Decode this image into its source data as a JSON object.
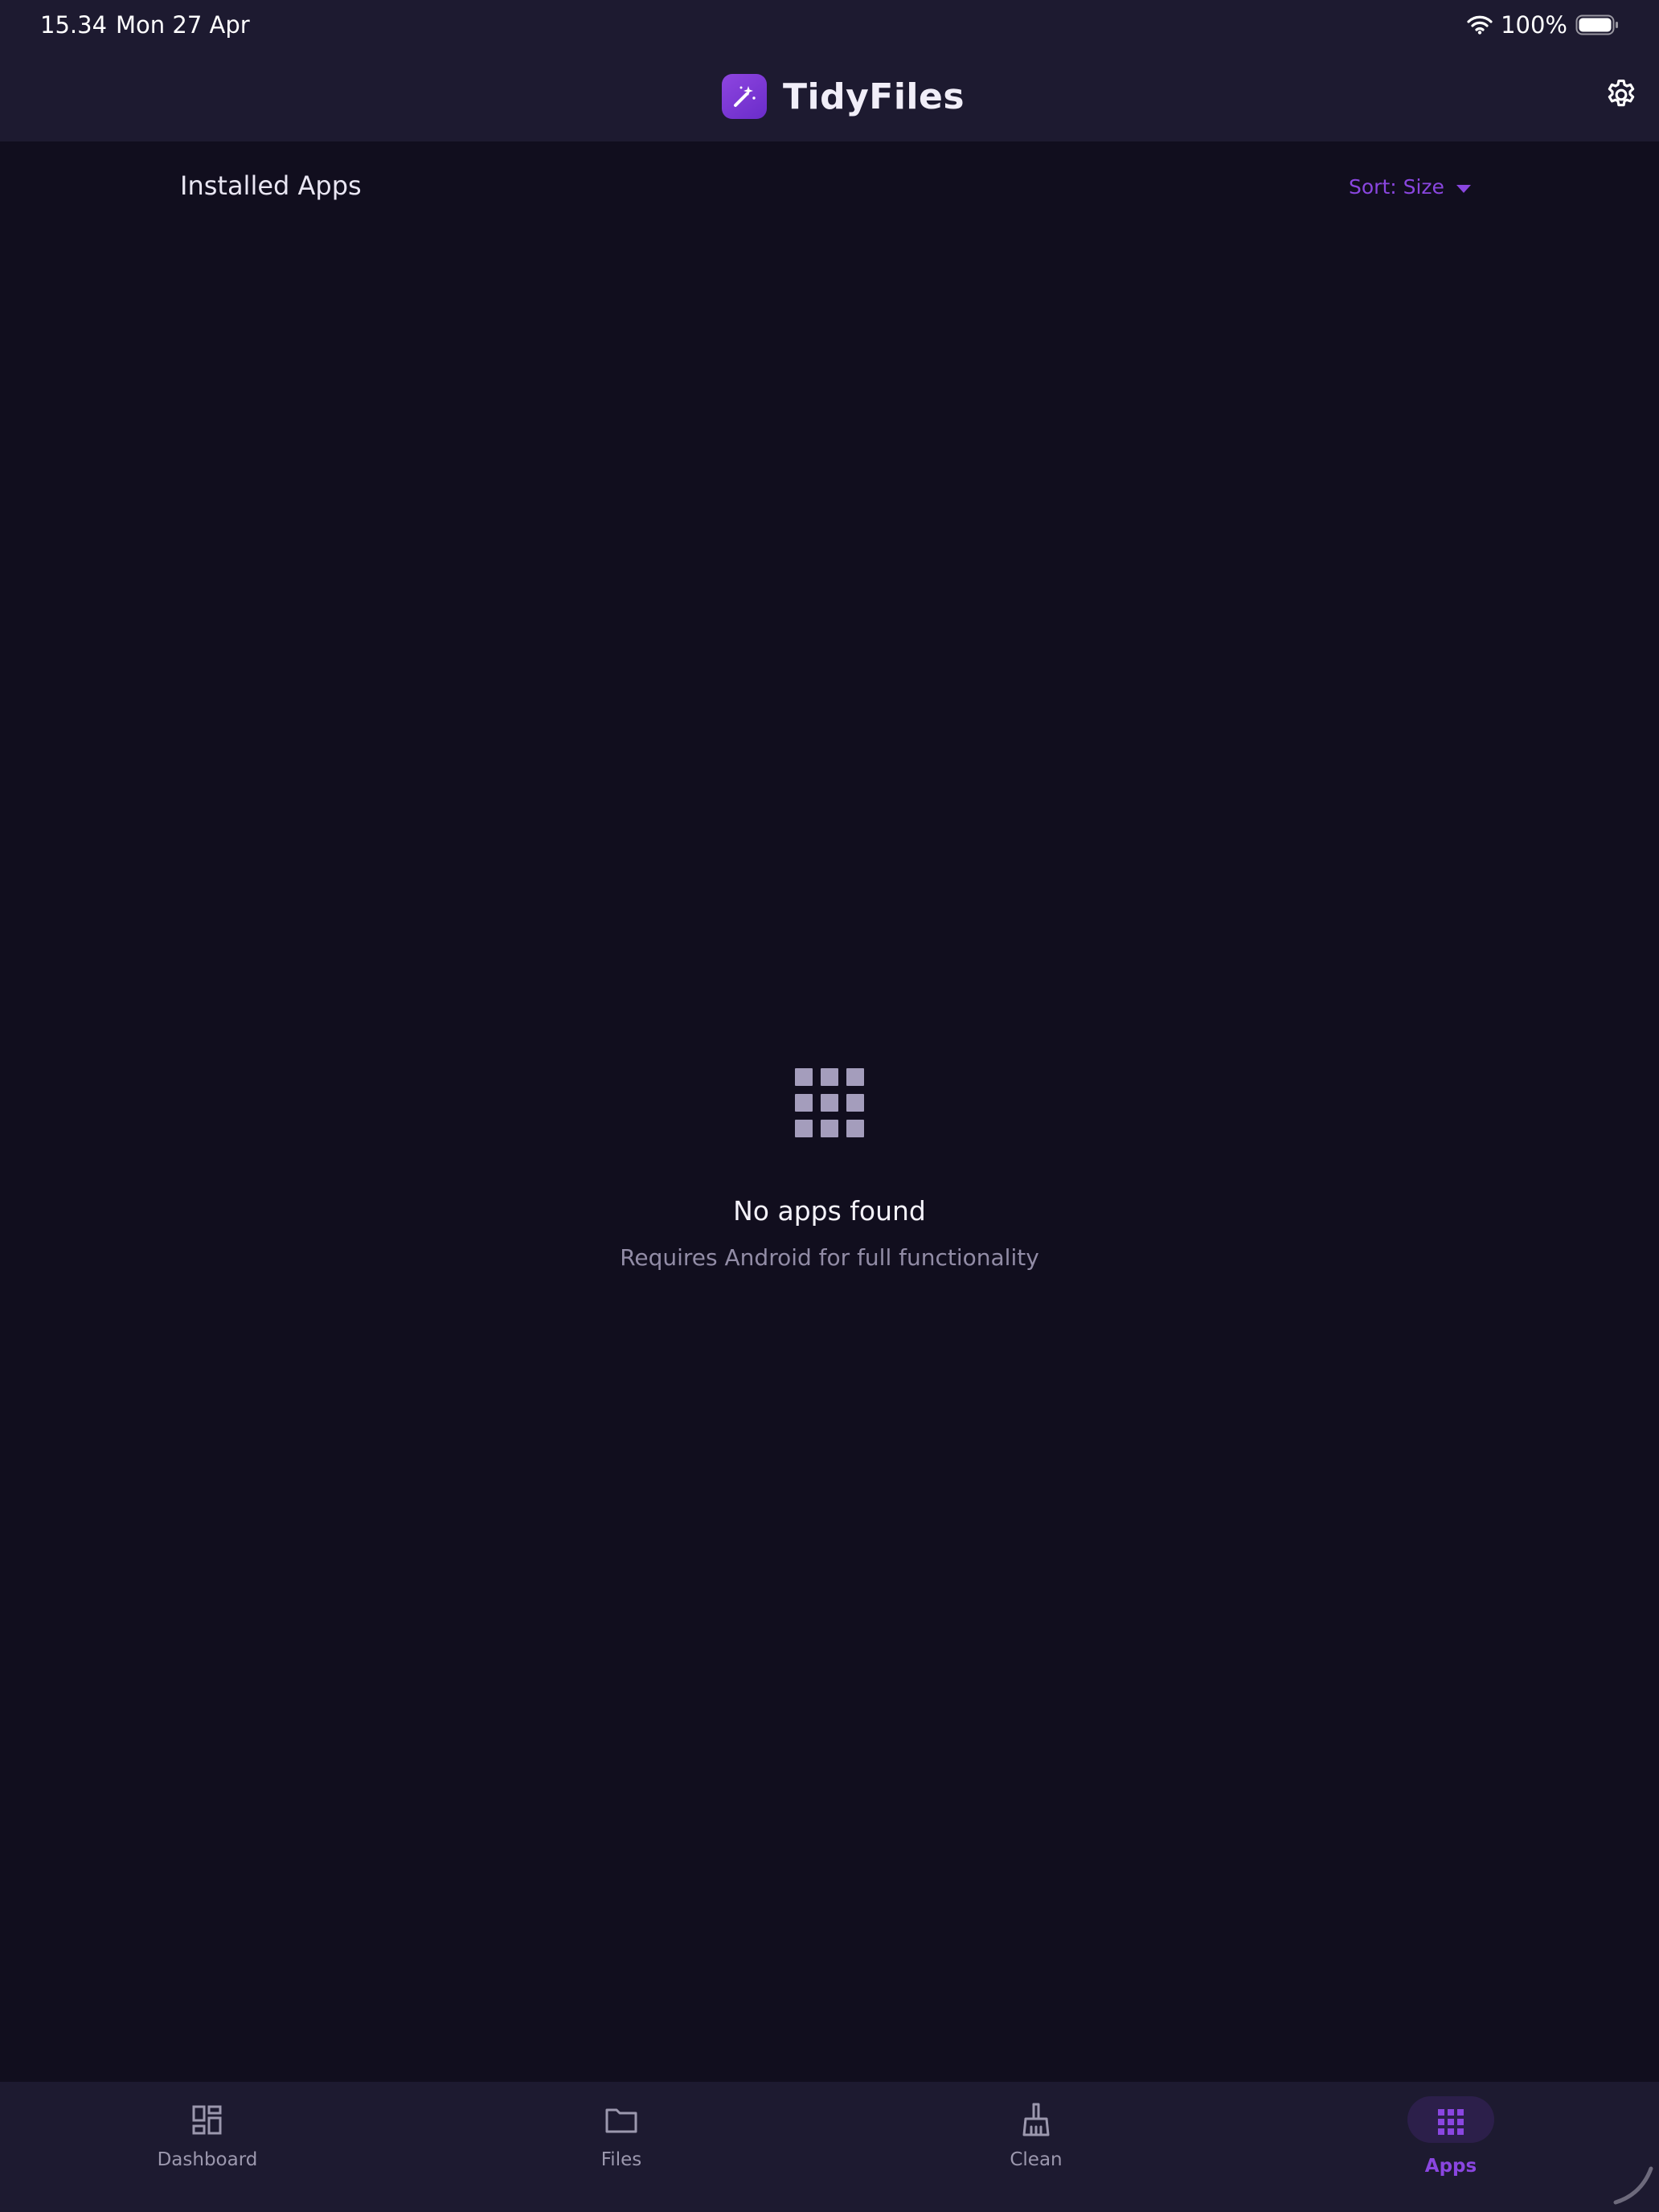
{
  "status_bar": {
    "time": "15.34",
    "date": "Mon 27 Apr",
    "battery": "100%",
    "icons": [
      "wifi-icon",
      "battery-icon"
    ]
  },
  "app_bar": {
    "title": "TidyFiles",
    "logo_icon": "magic-wand-icon",
    "settings_icon": "gear-icon"
  },
  "section": {
    "title": "Installed Apps",
    "sort_label": "Sort: Size",
    "sort_icon": "dropdown-arrow-icon"
  },
  "empty_state": {
    "icon": "apps-grid-icon",
    "title": "No apps found",
    "subtitle": "Requires Android for full functionality"
  },
  "nav": {
    "items": [
      {
        "label": "Dashboard",
        "icon": "dashboard-icon",
        "active": false
      },
      {
        "label": "Files",
        "icon": "folder-icon",
        "active": false
      },
      {
        "label": "Clean",
        "icon": "broom-icon",
        "active": false
      },
      {
        "label": "Apps",
        "icon": "apps-grid-icon",
        "active": true
      }
    ]
  },
  "colors": {
    "background": "#110e1e",
    "surface": "#1d1a30",
    "accent": "#8a46e0",
    "muted_text": "#928ca6"
  }
}
